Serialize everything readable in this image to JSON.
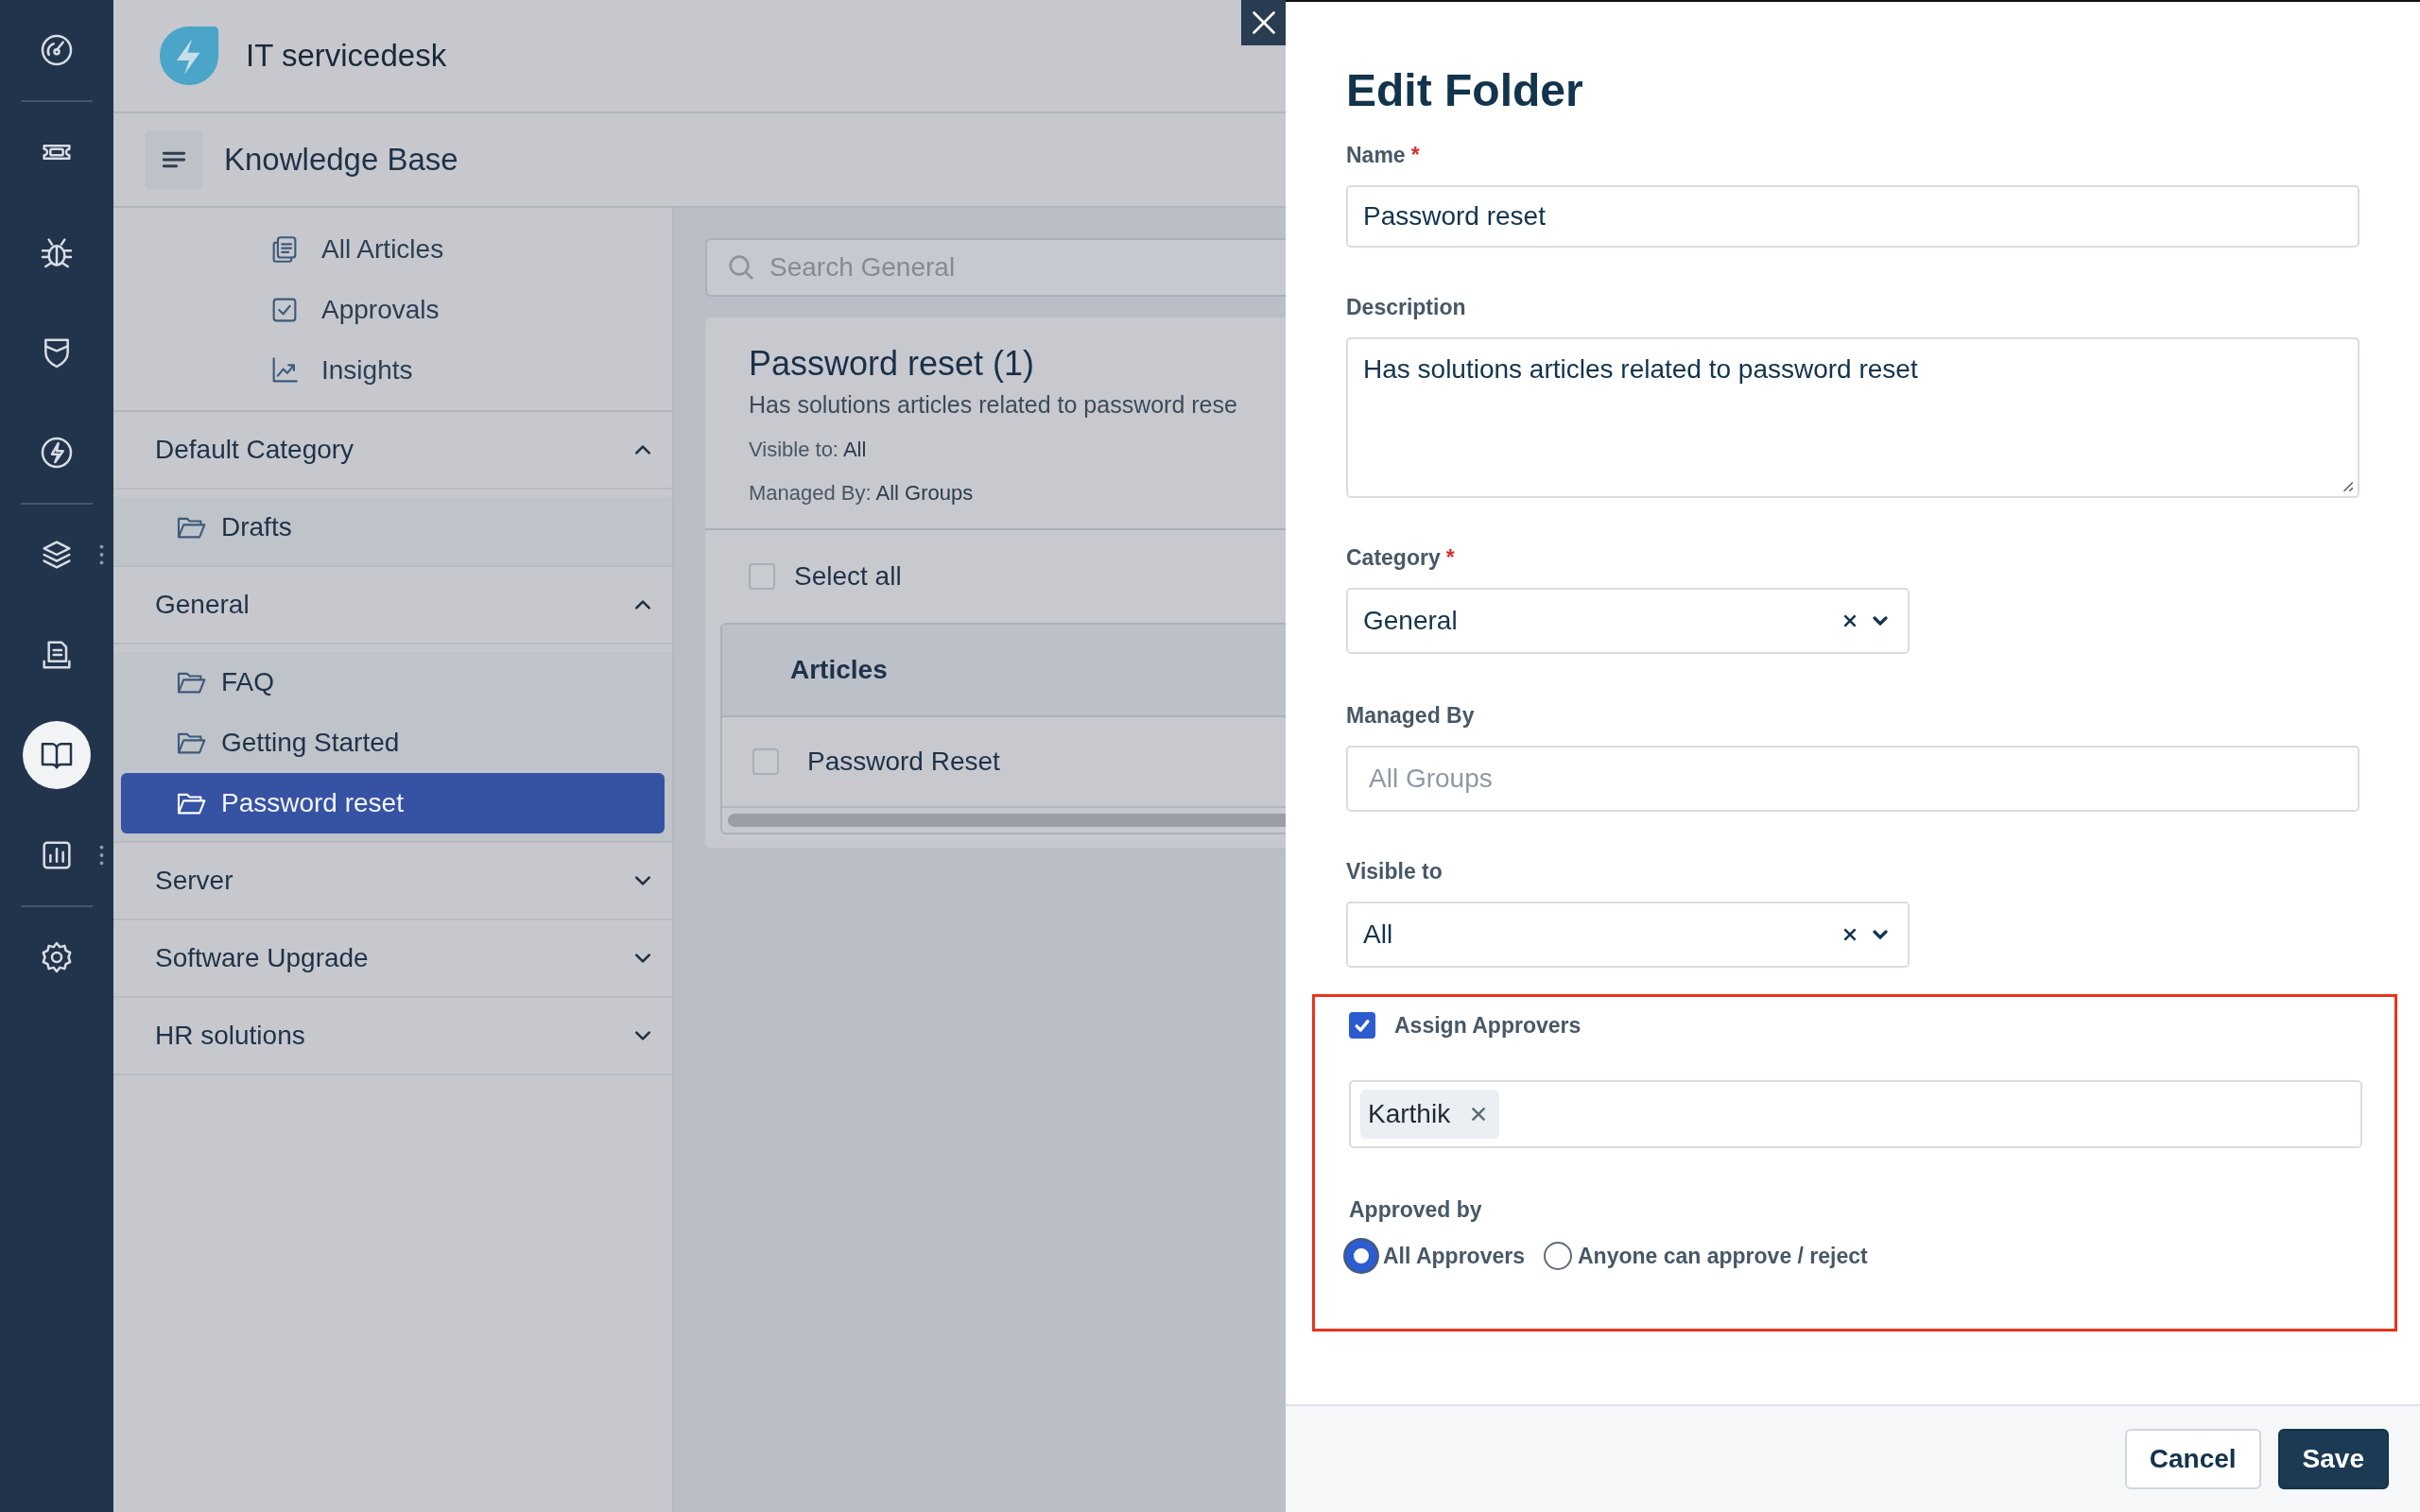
{
  "app": {
    "title": "IT servicedesk"
  },
  "rail_groups": [
    {
      "items": [
        {
          "selected": false,
          "has_menu": false
        }
      ]
    },
    {
      "items": [
        {
          "selected": false,
          "has_menu": false
        },
        {
          "selected": false,
          "has_menu": false
        },
        {
          "selected": false,
          "has_menu": false
        },
        {
          "selected": false,
          "has_menu": false
        }
      ]
    },
    {
      "items": [
        {
          "selected": false,
          "has_menu": true
        },
        {
          "selected": false,
          "has_menu": false
        },
        {
          "selected": true,
          "has_menu": false
        },
        {
          "selected": false,
          "has_menu": true
        }
      ]
    },
    {
      "items": [
        {
          "selected": false,
          "has_menu": false
        }
      ]
    }
  ],
  "module": {
    "title": "Knowledge Base"
  },
  "nav_links": [
    {
      "label": "All Articles"
    },
    {
      "label": "Approvals"
    },
    {
      "label": "Insights"
    }
  ],
  "categories": [
    {
      "name": "Default Category",
      "expanded": true,
      "folders": [
        {
          "name": "Drafts",
          "selected": false
        }
      ]
    },
    {
      "name": "General",
      "expanded": true,
      "folders": [
        {
          "name": "FAQ",
          "selected": false
        },
        {
          "name": "Getting Started",
          "selected": false
        },
        {
          "name": "Password reset",
          "selected": true
        }
      ]
    },
    {
      "name": "Server",
      "expanded": false
    },
    {
      "name": "Software Upgrade",
      "expanded": false
    },
    {
      "name": "HR solutions",
      "expanded": false
    }
  ],
  "search": {
    "placeholder": "Search General"
  },
  "folder_card": {
    "title": "Password reset (1)",
    "description": "Has solutions articles related to password rese",
    "visible_label": "Visible to:",
    "visible_value": "All",
    "managed_label": "Managed By:",
    "managed_value": "All Groups"
  },
  "select_all": {
    "label": "Select all",
    "checked": false
  },
  "table": {
    "columns": [
      "Articles"
    ],
    "rows": [
      {
        "title": "Password Reset",
        "checked": false
      }
    ]
  },
  "dialog": {
    "title": "Edit Folder",
    "name": {
      "label": "Name",
      "required_mark": "*",
      "value": "Password reset"
    },
    "description": {
      "label": "Description",
      "value": "Has solutions articles related to password reset"
    },
    "category": {
      "label": "Category",
      "required_mark": "*",
      "value": "General"
    },
    "managed_by": {
      "label": "Managed By",
      "placeholder": "All Groups"
    },
    "visible_to": {
      "label": "Visible to",
      "value": "All"
    },
    "approvers": {
      "highlighted": true,
      "label": "Assign Approvers",
      "checked": true,
      "people": [
        "Karthik"
      ]
    },
    "approved_by": {
      "label": "Approved by",
      "options": [
        {
          "label": "All Approvers",
          "selected": true
        },
        {
          "label": "Anyone can approve / reject",
          "selected": false
        }
      ]
    },
    "buttons": [
      {
        "label": "Cancel",
        "kind": "secondary"
      },
      {
        "label": "Save",
        "kind": "primary"
      }
    ]
  }
}
